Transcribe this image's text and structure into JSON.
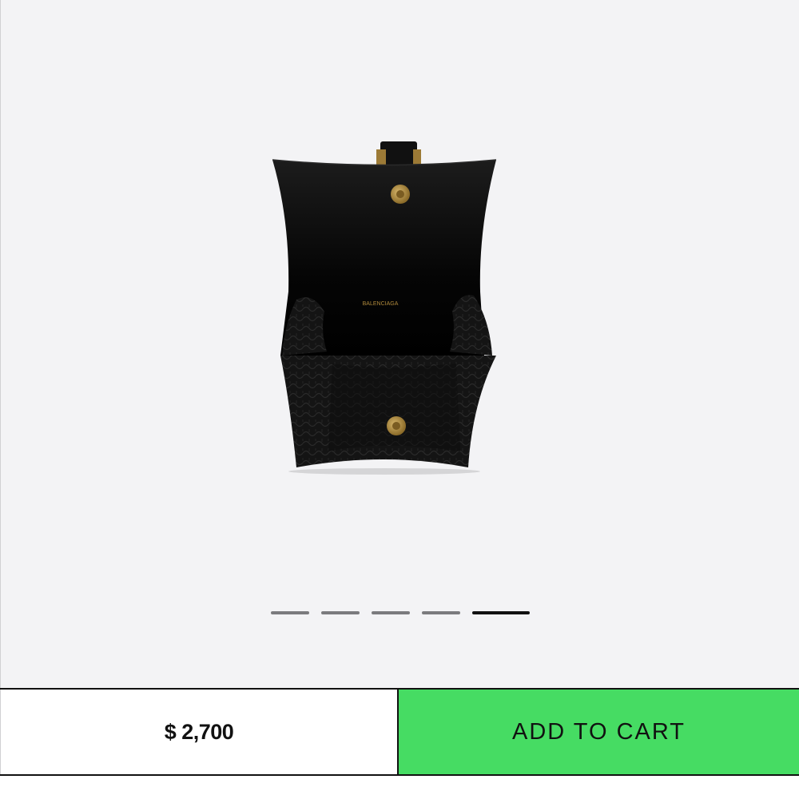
{
  "product": {
    "image_label": "black croc-embossed hourglass handbag, open view",
    "brand_stamp": "BALENCIAGA"
  },
  "carousel": {
    "slides": 5,
    "active_index": 4
  },
  "purchase": {
    "price": "$ 2,700",
    "add_to_cart_label": "ADD TO CART"
  },
  "colors": {
    "viewer_bg": "#f3f3f5",
    "cta_green": "#46dc63",
    "text": "#111111"
  }
}
